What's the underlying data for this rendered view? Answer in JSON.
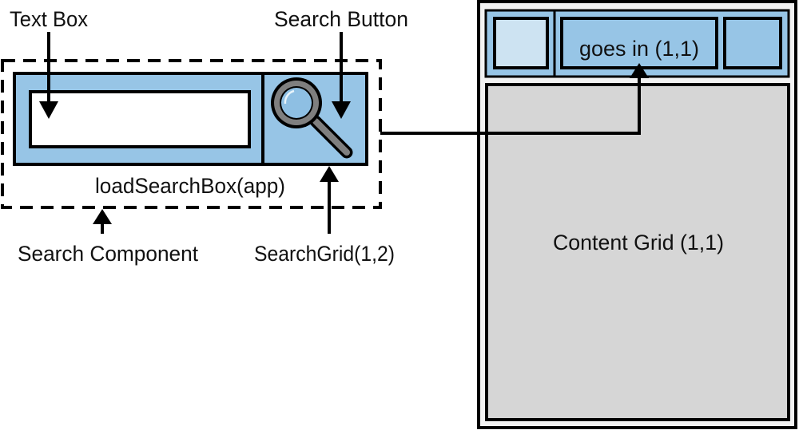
{
  "colors": {
    "blue": "#97c5e6",
    "light_blue": "#cde3f2",
    "gray_fill": "#d6d6d6",
    "frame_fill": "#f2f2f2",
    "stroke": "#000000",
    "magnifier_gray": "#7f7f7f"
  },
  "labels": {
    "text_box": "Text Box",
    "search_button": "Search Button",
    "load_search_box": "loadSearchBox(app)",
    "search_component": "Search Component",
    "search_grid": "SearchGrid(1,2)",
    "goes_in": "goes in (1,1)",
    "content_grid": "Content Grid (1,1)"
  },
  "icons": {
    "search_button_icon": "magnifying-glass-icon"
  }
}
